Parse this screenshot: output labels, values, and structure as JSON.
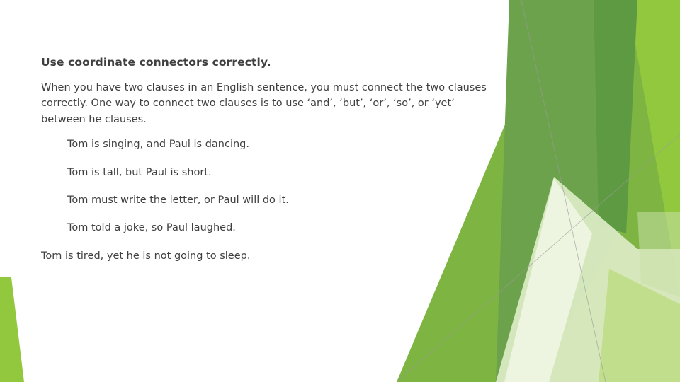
{
  "slide": {
    "heading": "Use coordinate connectors correctly.",
    "paragraph": "When you have two clauses in an English sentence, you must connect the two clauses correctly. One way to connect two clauses is to use ‘and’, ‘but’, ‘or’, ‘so’, or ‘yet’ between he clauses.",
    "examples": [
      {
        "text": "Tom is singing, and Paul is dancing.",
        "indented": true
      },
      {
        "text": "Tom is tall, but Paul is short.",
        "indented": true
      },
      {
        "text": "Tom must write the letter, or Paul will do it.",
        "indented": true
      },
      {
        "text": "Tom told a joke, so Paul laughed.",
        "indented": true
      },
      {
        "text": "Tom is tired, yet he is not going to sleep.",
        "indented": false
      }
    ]
  },
  "theme": {
    "name": "facet",
    "background": "#FFFFFF",
    "text_color": "#404040",
    "accent_bright_green": "#92C83E",
    "accent_mid_green": "#7DB442",
    "accent_medium_green": "#6DA24D",
    "accent_dark_green": "#5E9A42",
    "accent_pale_green": "#DDEBC6",
    "accent_very_pale_green": "#EDF4E0",
    "hairline_color": "#9A9A9A"
  }
}
